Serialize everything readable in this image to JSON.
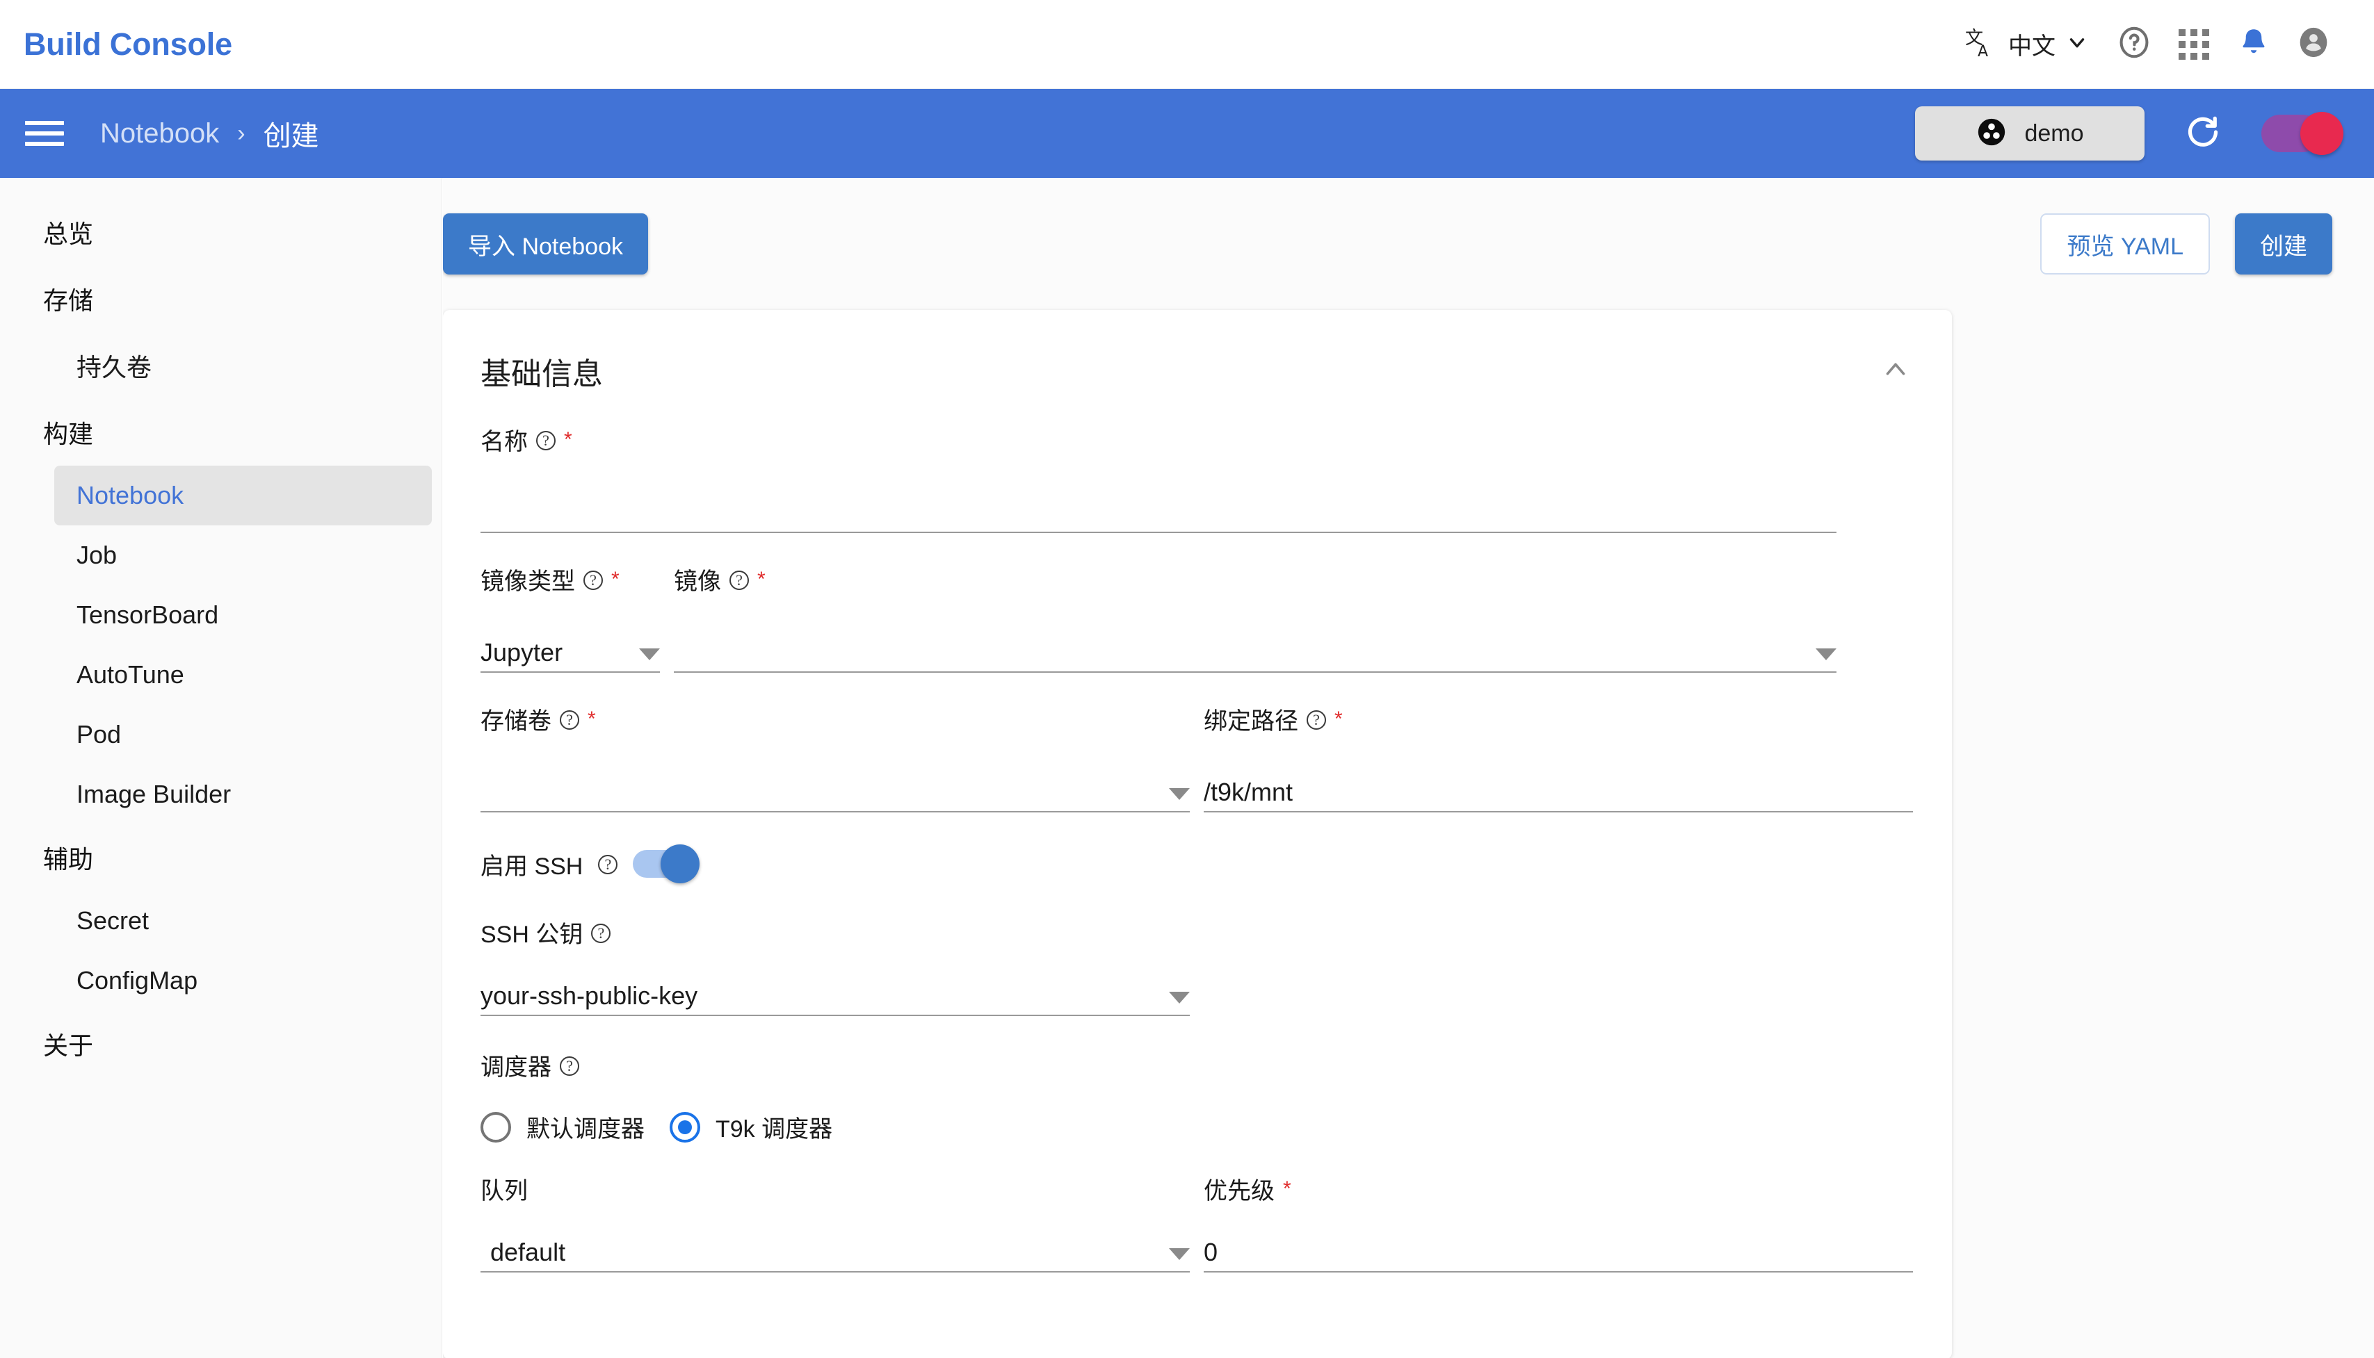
{
  "appbar": {
    "brand": "Build Console",
    "translate_icon": "translate-icon",
    "language": "中文",
    "chevron": "chevron-down-icon",
    "help_icon": "help-circle-icon",
    "apps_icon": "apps-grid-icon",
    "bell_icon": "notification-bell-icon",
    "account_icon": "account-circle-icon",
    "bell_color": "#3b72d6"
  },
  "navbar": {
    "menu_icon": "hamburger-menu-icon",
    "breadcrumb_parent": "Notebook",
    "breadcrumb_separator": "›",
    "breadcrumb_current": "创建",
    "project_chip": "demo",
    "project_icon": "project-dots-icon",
    "refresh_icon": "refresh-icon",
    "user_badge_icon": "user-badge-icon",
    "bg_color": "#4273d6"
  },
  "sidebar": {
    "items": [
      {
        "label": "总览",
        "level": "group",
        "active": false
      },
      {
        "label": "存储",
        "level": "group",
        "active": false
      },
      {
        "label": "持久卷",
        "level": "item",
        "active": false
      },
      {
        "label": "构建",
        "level": "group",
        "active": false
      },
      {
        "label": "Notebook",
        "level": "item",
        "active": true
      },
      {
        "label": "Job",
        "level": "item",
        "active": false
      },
      {
        "label": "TensorBoard",
        "level": "item",
        "active": false
      },
      {
        "label": "AutoTune",
        "level": "item",
        "active": false
      },
      {
        "label": "Pod",
        "level": "item",
        "active": false
      },
      {
        "label": "Image Builder",
        "level": "item",
        "active": false
      },
      {
        "label": "辅助",
        "level": "group",
        "active": false
      },
      {
        "label": "Secret",
        "level": "item",
        "active": false
      },
      {
        "label": "ConfigMap",
        "level": "item",
        "active": false
      },
      {
        "label": "关于",
        "level": "group",
        "active": false
      }
    ],
    "active_color": "#4273d6"
  },
  "toolbar": {
    "import_label": "导入 Notebook",
    "preview_yaml_label": "预览 YAML",
    "create_label": "创建",
    "primary_color": "#3c7ac9"
  },
  "form": {
    "section_title": "基础信息",
    "collapse_icon": "chevron-up-icon",
    "required_mark": "*",
    "help_icon": "help-circle-icon",
    "name": {
      "label": "名称",
      "value": "",
      "required": true
    },
    "image_type": {
      "label": "镜像类型",
      "value": "Jupyter",
      "required": true
    },
    "image": {
      "label": "镜像",
      "value": "",
      "required": true
    },
    "volume": {
      "label": "存储卷",
      "value": "",
      "required": true
    },
    "mount_path": {
      "label": "绑定路径",
      "value": "/t9k/mnt",
      "required": true
    },
    "ssh_enable": {
      "label": "启用 SSH",
      "enabled": true
    },
    "ssh_key": {
      "label": "SSH 公钥",
      "value": "your-ssh-public-key",
      "required": false
    },
    "scheduler": {
      "label": "调度器",
      "options": [
        {
          "label": "默认调度器",
          "selected": false
        },
        {
          "label": "T9k 调度器",
          "selected": true
        }
      ]
    },
    "queue": {
      "label": "队列",
      "value": "default",
      "required": false
    },
    "priority": {
      "label": "优先级",
      "value": "0",
      "required": true
    }
  }
}
